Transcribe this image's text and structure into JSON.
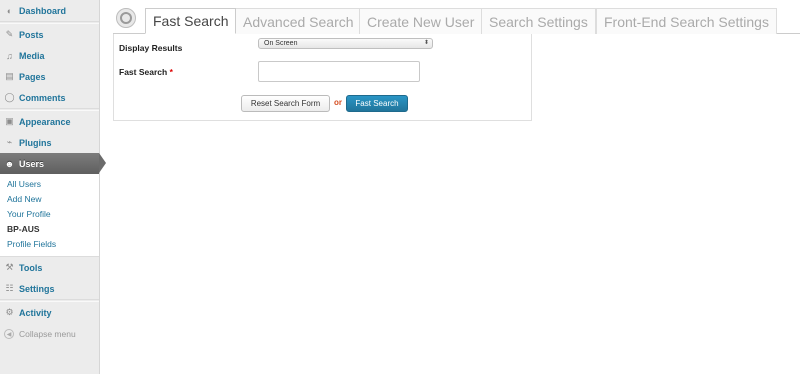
{
  "sidebar": {
    "items": [
      {
        "label": "Dashboard",
        "icon": "dashboard-icon"
      },
      {
        "label": "Posts",
        "icon": "posts-icon"
      },
      {
        "label": "Media",
        "icon": "media-icon"
      },
      {
        "label": "Pages",
        "icon": "pages-icon"
      },
      {
        "label": "Comments",
        "icon": "comments-icon"
      },
      {
        "label": "Appearance",
        "icon": "appearance-icon"
      },
      {
        "label": "Plugins",
        "icon": "plugins-icon"
      },
      {
        "label": "Users",
        "icon": "users-icon"
      },
      {
        "label": "Tools",
        "icon": "tools-icon"
      },
      {
        "label": "Settings",
        "icon": "settings-icon"
      },
      {
        "label": "Activity",
        "icon": "activity-icon"
      }
    ],
    "users_submenu": [
      "All Users",
      "Add New",
      "Your Profile",
      "BP-AUS",
      "Profile Fields"
    ],
    "collapse_label": "Collapse menu"
  },
  "tabs": [
    {
      "label": "Fast Search",
      "active": true
    },
    {
      "label": "Advanced Search",
      "active": false
    },
    {
      "label": "Create New User",
      "active": false
    },
    {
      "label": "Search Settings",
      "active": false
    },
    {
      "label": "Front-End Search Settings",
      "active": false
    }
  ],
  "form": {
    "display_results_label": "Display Results",
    "display_results_value": "On Screen",
    "fast_search_label": "Fast Search",
    "required_mark": "*",
    "fast_search_value": "",
    "reset_button": "Reset Search Form",
    "or_text": "or",
    "submit_button": "Fast Search"
  },
  "colors": {
    "link": "#21759b",
    "current_menu_bg": "#6b6b6b",
    "primary_button": "#21759b",
    "or_text": "#d54e21",
    "required": "#dd0000"
  }
}
